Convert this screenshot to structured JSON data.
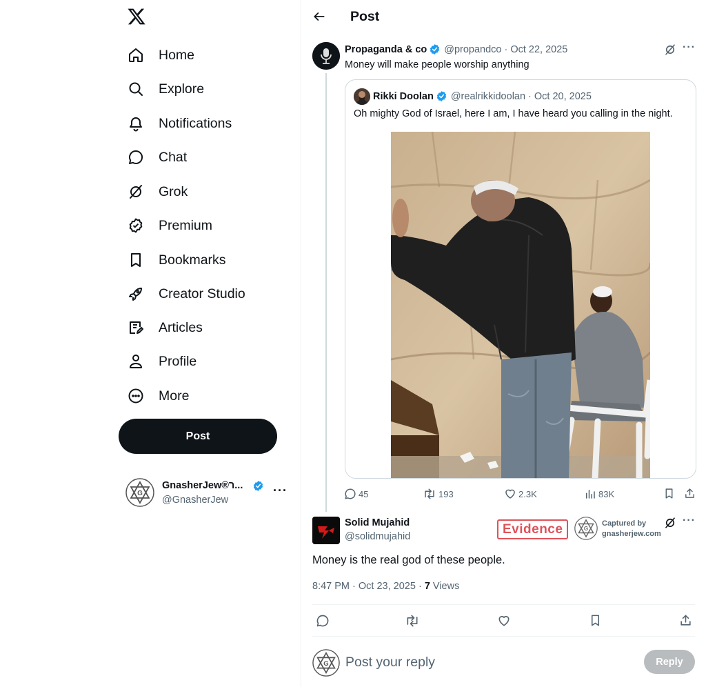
{
  "nav": {
    "items": [
      {
        "label": "Home",
        "icon": "home-icon"
      },
      {
        "label": "Explore",
        "icon": "search-icon"
      },
      {
        "label": "Notifications",
        "icon": "bell-icon"
      },
      {
        "label": "Chat",
        "icon": "chat-bubble-icon"
      },
      {
        "label": "Grok",
        "icon": "grok-icon"
      },
      {
        "label": "Premium",
        "icon": "verified-badge-icon"
      },
      {
        "label": "Bookmarks",
        "icon": "bookmark-icon"
      },
      {
        "label": "Creator Studio",
        "icon": "rocket-icon"
      },
      {
        "label": "Articles",
        "icon": "article-icon"
      },
      {
        "label": "Profile",
        "icon": "person-icon"
      },
      {
        "label": "More",
        "icon": "more-circle-icon"
      }
    ],
    "post_label": "Post"
  },
  "account": {
    "name": "GnasherJew®ר...",
    "handle": "@GnasherJew",
    "more": "···"
  },
  "header": {
    "title": "Post"
  },
  "post1": {
    "name": "Propaganda & co",
    "handle": "@propandco",
    "date": "Oct 22, 2025",
    "text": "Money will make people worship anything",
    "more": "···"
  },
  "quote": {
    "name": "Rikki Doolan",
    "handle": "@realrikkidoolan",
    "date": "Oct 20, 2025",
    "text": "Oh mighty God of Israel, here I am, I have heard you calling in the night."
  },
  "post1_actions": {
    "replies": "45",
    "reposts": "193",
    "likes": "2.3K",
    "views": "83K"
  },
  "post2": {
    "name": "Solid Mujahid",
    "handle": "@solidmujahid",
    "text": "Money is the real god of these people.",
    "time": "8:47 PM · Oct 23, 2025 · ",
    "views_count": "7",
    "views_label": " Views",
    "more": "···"
  },
  "overlay": {
    "evidence": "Evidence",
    "captured_by": "Captured by",
    "captured_site": "gnasherjew.com"
  },
  "reply": {
    "placeholder": "Post your reply",
    "button": "Reply"
  },
  "colors": {
    "text": "#0f1419",
    "muted": "#536471",
    "verified": "#1d9bf0",
    "border": "#cfd9de",
    "evidence_red": "#e0525a"
  }
}
